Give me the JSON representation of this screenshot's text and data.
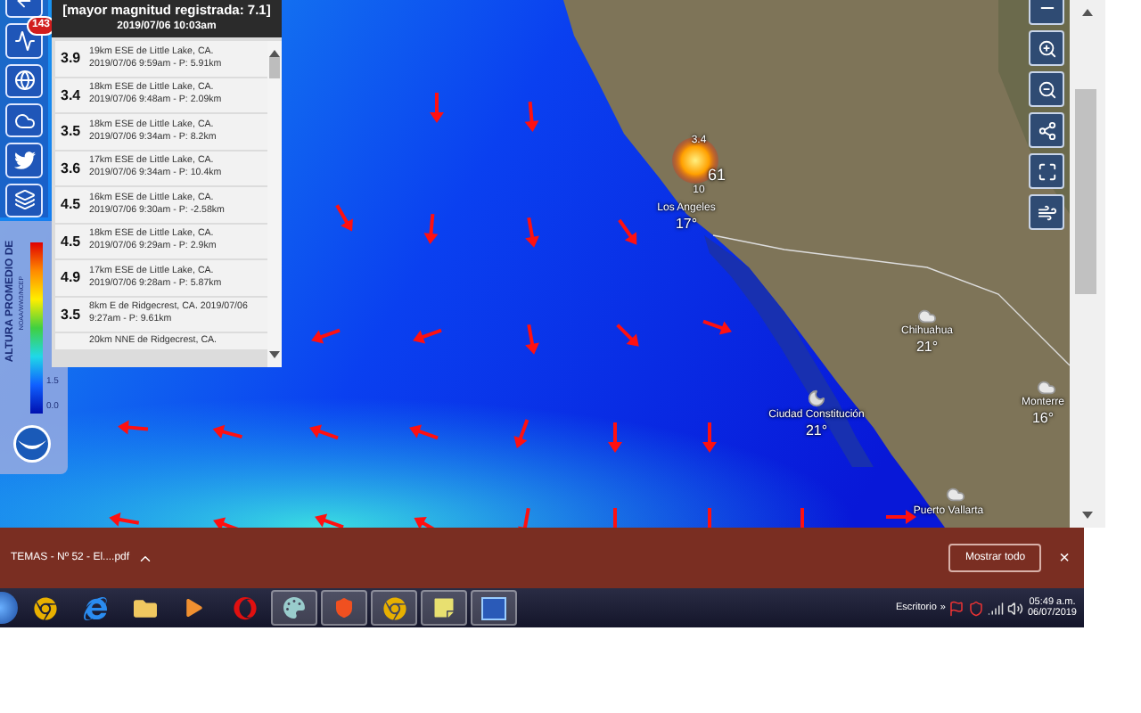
{
  "toolbar": {
    "badge": "143"
  },
  "quake_panel": {
    "header": [
      "[mayor magnitud registrada: 7.1]",
      "2019/07/06 10:03am"
    ],
    "events": [
      {
        "magnitude": "3.9",
        "place": "19km ESE de Little Lake, CA.",
        "time": "2019/07/06 9:59am - P: 5.91km"
      },
      {
        "magnitude": "3.4",
        "place": "18km ESE de Little Lake, CA.",
        "time": "2019/07/06 9:48am - P: 2.09km"
      },
      {
        "magnitude": "3.5",
        "place": "18km ESE de Little Lake, CA.",
        "time": "2019/07/06 9:34am - P: 8.2km"
      },
      {
        "magnitude": "3.6",
        "place": "17km ESE de Little Lake, CA.",
        "time": "2019/07/06 9:34am - P: 10.4km"
      },
      {
        "magnitude": "4.5",
        "place": "16km ESE de Little Lake, CA.",
        "time": "2019/07/06 9:30am - P: -2.58km"
      },
      {
        "magnitude": "4.5",
        "place": "18km ESE de Little Lake, CA.",
        "time": "2019/07/06 9:29am - P: 2.9km"
      },
      {
        "magnitude": "4.9",
        "place": "17km ESE de Little Lake, CA.",
        "time": "2019/07/06 9:28am - P: 5.87km"
      },
      {
        "magnitude": "3.5",
        "place": "8km E de Ridgecrest, CA. 2019/07/06",
        "time": "9:27am - P: 9.61km"
      },
      {
        "place": "20km NNE de Ridgecrest, CA."
      }
    ]
  },
  "legend": {
    "title": "ALTURA PROMEDIO DE",
    "subtitle": "NOAA/WW3/NCEP",
    "ticks": [
      "1.5",
      "0.0"
    ]
  },
  "map": {
    "quake_labels": [
      "3.4",
      "61",
      "10"
    ],
    "cities": [
      {
        "kind": "plain",
        "name": "Los Angeles",
        "temp": "17°"
      },
      {
        "kind": "cloudy",
        "name": "Chihuahua",
        "temp": "21°"
      },
      {
        "kind": "night",
        "name": "Ciudad Constitución",
        "temp": "21°"
      },
      {
        "kind": "cloudy",
        "name": "Monterre",
        "temp": "16°"
      },
      {
        "kind": "cloudy",
        "name": "Puerto Vallarta"
      }
    ]
  },
  "download_bar": {
    "file": "TEMAS - Nº 52 - El....pdf",
    "button": "Mostrar todo",
    "close": "×"
  },
  "taskbar": {
    "desktop_label": "Escritorio",
    "overflow": "»",
    "time": "05:49 a.m.",
    "date": "06/07/2019"
  }
}
